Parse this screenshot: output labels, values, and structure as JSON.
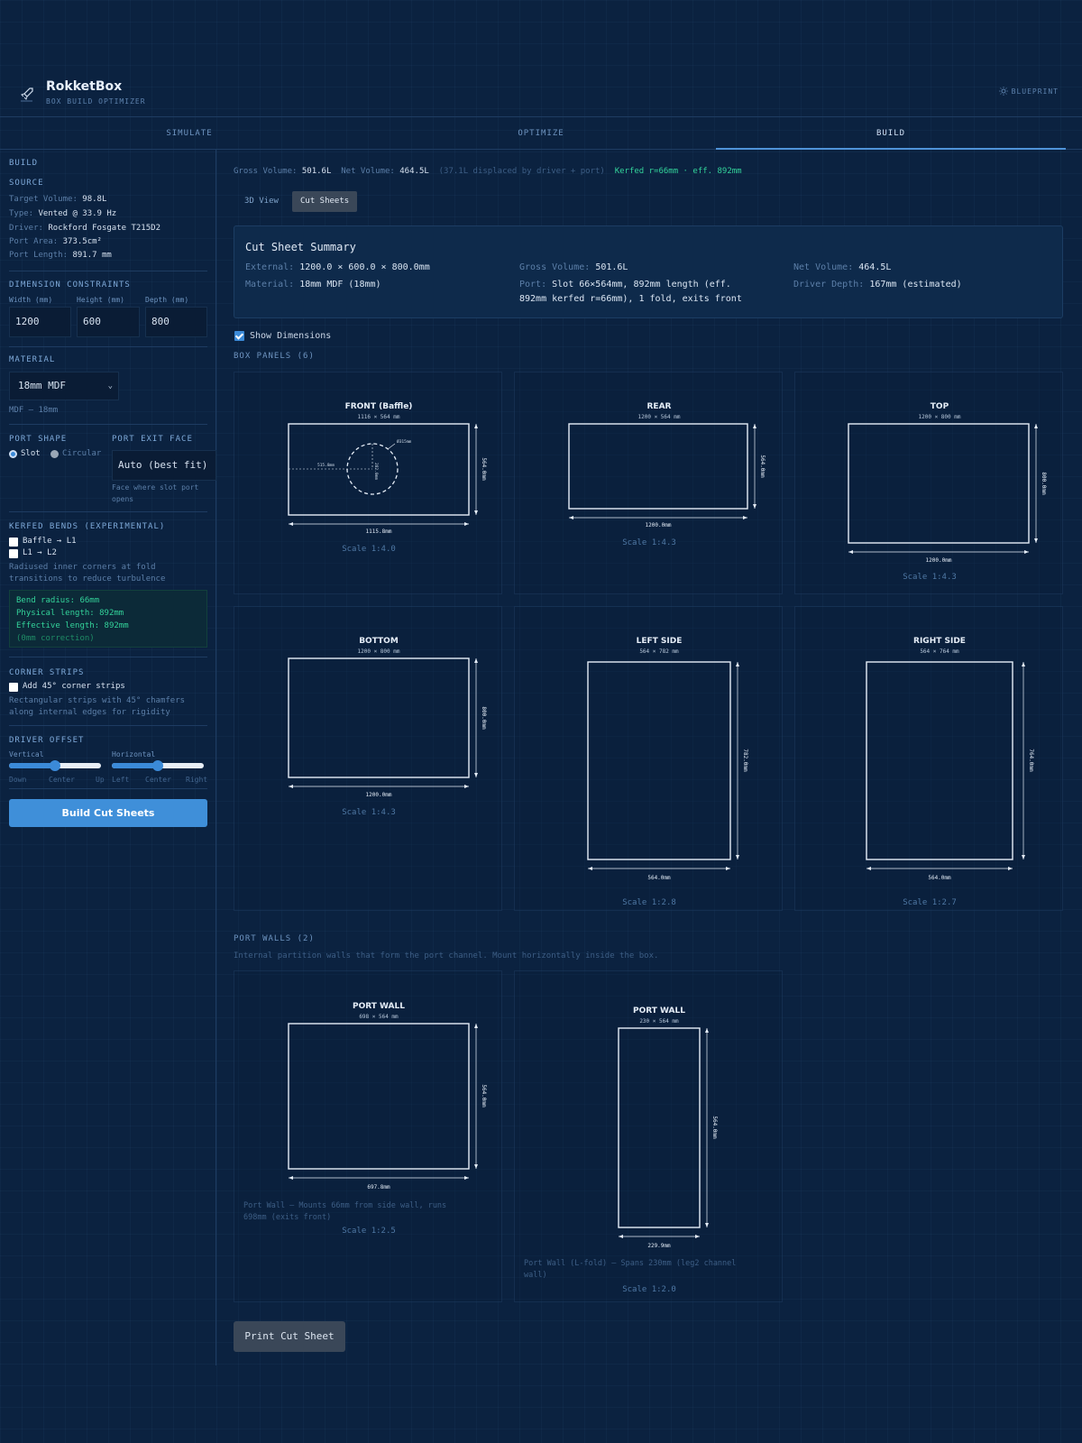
{
  "app": {
    "title": "RokketBox",
    "subtitle": "BOX BUILD OPTIMIZER",
    "badge": "BLUEPRINT"
  },
  "tabs": [
    {
      "label": "SIMULATE",
      "active": false
    },
    {
      "label": "OPTIMIZE",
      "active": false
    },
    {
      "label": "BUILD",
      "active": true
    }
  ],
  "sidebar": {
    "heading": "BUILD",
    "source": {
      "heading": "SOURCE",
      "lines": [
        {
          "k": "Target Volume:",
          "v": "98.8L"
        },
        {
          "k": "Type:",
          "v": "Vented @ 33.9 Hz"
        },
        {
          "k": "Driver:",
          "v": "Rockford Fosgate T215D2"
        },
        {
          "k": "Port Area:",
          "v": "373.5cm²"
        },
        {
          "k": "Port Length:",
          "v": "891.7 mm"
        }
      ]
    },
    "dims": {
      "heading": "DIMENSION CONSTRAINTS",
      "width_label": "Width (mm)",
      "width": "1200",
      "height_label": "Height (mm)",
      "height": "600",
      "depth_label": "Depth (mm)",
      "depth": "800"
    },
    "material": {
      "heading": "MATERIAL",
      "selected": "18mm MDF",
      "note": "MDF — 18mm"
    },
    "port_shape": {
      "heading": "PORT SHAPE",
      "slot": "Slot",
      "circular": "Circular",
      "selected": "slot"
    },
    "port_exit": {
      "heading": "PORT EXIT FACE",
      "value": "Auto (best fit)",
      "note_1": "Face where slot port",
      "note_2": "opens"
    },
    "kerfed": {
      "heading": "KERFED BENDS (EXPERIMENTAL)",
      "opt1": "Baffle → L1",
      "opt2": "L1 → L2",
      "desc_1": "Radiused inner corners at fold",
      "desc_2": "transitions to reduce turbulence",
      "info": [
        "Bend radius: 66mm",
        "Physical length: 892mm",
        "Effective length: 892mm",
        "(0mm correction)"
      ]
    },
    "corner": {
      "heading": "CORNER STRIPS",
      "opt": "Add 45° corner strips",
      "desc_1": "Rectangular strips with 45° chamfers",
      "desc_2": "along internal edges for rigidity"
    },
    "offset": {
      "heading": "DRIVER OFFSET",
      "vertical": "Vertical",
      "horizontal": "Horizontal",
      "v_down": "Down",
      "v_center": "Center",
      "v_up": "Up",
      "h_left": "Left",
      "h_center": "Center",
      "h_right": "Right",
      "vertical_value": 0.5,
      "horizontal_value": 0.5
    },
    "build_button": "Build Cut Sheets"
  },
  "main": {
    "volumes": {
      "gross_k": "Gross Volume:",
      "gross_v": "501.6L",
      "net_k": "Net Volume:",
      "net_v": "464.5L",
      "displaced": "(37.1L displaced by driver + port)",
      "kerfed": "Kerfed r=66mm · eff. 892mm"
    },
    "view_tabs": {
      "view3d": "3D View",
      "cut": "Cut Sheets"
    },
    "summary": {
      "title": "Cut Sheet Summary",
      "external_k": "External:",
      "external_v": "1200.0 × 600.0 × 800.0mm",
      "material_k": "Material:",
      "material_v": "18mm MDF (18mm)",
      "gross_k": "Gross Volume:",
      "gross_v": "501.6L",
      "port_k": "Port:",
      "port_v1": "Slot 66×564mm, 892mm length (eff.",
      "port_v2": "892mm kerfed r=66mm), 1 fold, exits front",
      "net_k": "Net Volume:",
      "net_v": "464.5L",
      "depth_k": "Driver Depth:",
      "depth_v": "167mm (estimated)"
    },
    "show_dimensions": "Show Dimensions",
    "box_panels_heading": "BOX PANELS (6)",
    "panels": [
      {
        "title": "FRONT (Baffle)",
        "size": "1116 × 564 mm",
        "w_dim": "1115.8mm",
        "h_dim": "564.0mm",
        "scale": "Scale 1:4.0",
        "cutout": {
          "dia": "Ø315mm",
          "x_off": "515.8mm",
          "y_off": "282.0mm"
        }
      },
      {
        "title": "REAR",
        "size": "1200 × 564 mm",
        "w_dim": "1200.0mm",
        "h_dim": "564.0mm",
        "scale": "Scale 1:4.3"
      },
      {
        "title": "TOP",
        "size": "1200 × 800 mm",
        "w_dim": "1200.0mm",
        "h_dim": "800.0mm",
        "scale": "Scale 1:4.3"
      },
      {
        "title": "BOTTOM",
        "size": "1200 × 800 mm",
        "w_dim": "1200.0mm",
        "h_dim": "800.0mm",
        "scale": "Scale 1:4.3"
      },
      {
        "title": "LEFT SIDE",
        "size": "564 × 782 mm",
        "w_dim": "564.0mm",
        "h_dim": "782.0mm",
        "scale": "Scale 1:2.8"
      },
      {
        "title": "RIGHT SIDE",
        "size": "564 × 764 mm",
        "w_dim": "564.0mm",
        "h_dim": "764.0mm",
        "scale": "Scale 1:2.7"
      }
    ],
    "port_walls_heading": "PORT WALLS (2)",
    "port_walls_desc": "Internal partition walls that form the port channel. Mount horizontally inside the box.",
    "port_walls": [
      {
        "title": "PORT WALL",
        "size": "698 × 564 mm",
        "w_dim": "697.8mm",
        "h_dim": "564.0mm",
        "note_1": "Port Wall — Mounts 66mm from side wall, runs",
        "note_2": "698mm (exits front)",
        "scale": "Scale 1:2.5"
      },
      {
        "title": "PORT WALL",
        "size": "230 × 564 mm",
        "w_dim": "229.9mm",
        "h_dim": "564.0mm",
        "note_1": "Port Wall (L-fold) — Spans 230mm (leg2 channel",
        "note_2": "wall)",
        "scale": "Scale 1:2.0"
      }
    ],
    "print_button": "Print Cut Sheet"
  },
  "colors": {
    "background": "#0b2240",
    "accent": "#3f8fd9",
    "success": "#33d39a",
    "line": "#e6eef8"
  }
}
